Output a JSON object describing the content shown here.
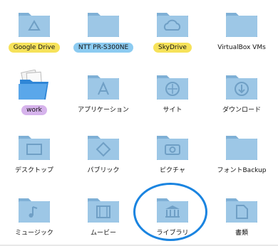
{
  "items": [
    {
      "label": "Google Drive",
      "emblem": "google-drive-icon",
      "tag_color": "#f6e25a"
    },
    {
      "label": "NTT PR-S300NE",
      "emblem": "none",
      "tag_color": "#8ccbf1"
    },
    {
      "label": "SkyDrive",
      "emblem": "cloud-icon",
      "tag_color": "#f6e25a"
    },
    {
      "label": "VirtualBox VMs",
      "emblem": "none",
      "tag_color": ""
    },
    {
      "label": "work",
      "emblem": "open-folder-with-files-icon",
      "tag_color": "#d6b3ec"
    },
    {
      "label": "アプリケーション",
      "emblem": "applications-icon",
      "tag_color": ""
    },
    {
      "label": "サイト",
      "emblem": "sites-compass-icon",
      "tag_color": ""
    },
    {
      "label": "ダウンロード",
      "emblem": "download-icon",
      "tag_color": ""
    },
    {
      "label": "デスクトップ",
      "emblem": "desktop-icon",
      "tag_color": ""
    },
    {
      "label": "パブリック",
      "emblem": "public-icon",
      "tag_color": ""
    },
    {
      "label": "ピクチャ",
      "emblem": "camera-icon",
      "tag_color": ""
    },
    {
      "label": "フォントBackup",
      "emblem": "none",
      "tag_color": ""
    },
    {
      "label": "ミュージック",
      "emblem": "music-note-icon",
      "tag_color": ""
    },
    {
      "label": "ムービー",
      "emblem": "film-icon",
      "tag_color": ""
    },
    {
      "label": "ライブラリ",
      "emblem": "library-icon",
      "tag_color": ""
    },
    {
      "label": "書類",
      "emblem": "document-icon",
      "tag_color": ""
    }
  ],
  "colors": {
    "folder": "#9dc7e6",
    "folder_dark": "#7fb0d6",
    "emblem": "#6f9fc5",
    "highlight": "#1a84e0"
  }
}
